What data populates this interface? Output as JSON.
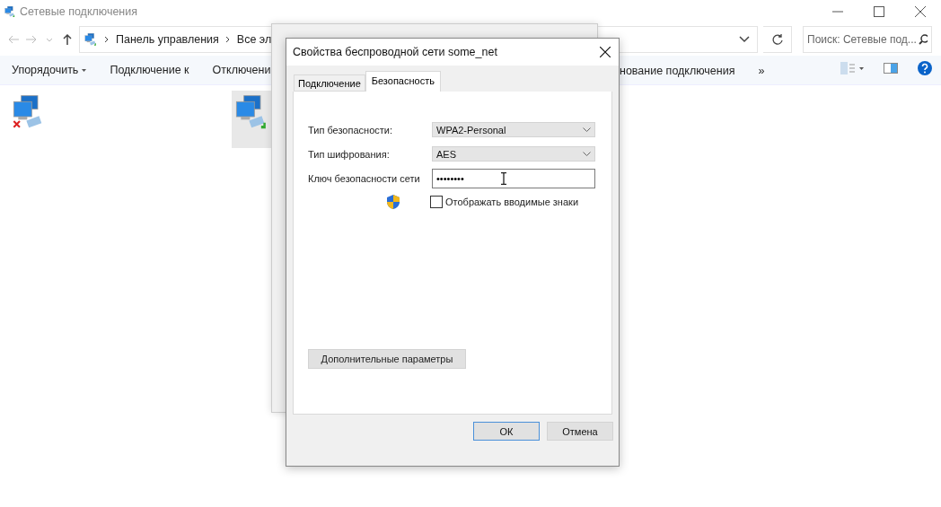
{
  "window": {
    "title": "Сетевые подключения"
  },
  "address_bar": {
    "crumbs": [
      "Панель управления",
      "Все эл"
    ]
  },
  "search": {
    "placeholder": "Поиск: Сетевые под..."
  },
  "toolbar": {
    "left": [
      {
        "label": "Упорядочить",
        "has_caret": true
      },
      {
        "label": "Подключение к",
        "has_caret": false
      },
      {
        "label": "Отключени",
        "has_caret": false
      }
    ],
    "right": [
      {
        "label": "нование подключения",
        "has_caret": false
      },
      {
        "label": "»",
        "has_caret": false
      }
    ]
  },
  "connections": [
    {
      "disconnected": true,
      "selected": false
    },
    {
      "disconnected": false,
      "selected": true
    }
  ],
  "dialog": {
    "title": "Свойства беспроводной сети some_net",
    "tabs": [
      {
        "label": "Подключение",
        "selected": false
      },
      {
        "label": "Безопасность",
        "selected": true
      }
    ],
    "fields": [
      {
        "kind": "select",
        "label": "Тип безопасности:",
        "value": "WPA2-Personal"
      },
      {
        "kind": "select",
        "label": "Тип шифрования:",
        "value": "AES"
      },
      {
        "kind": "password",
        "label": "Ключ безопасности сети",
        "value": "••••••••"
      }
    ],
    "show_chars": {
      "label": "Отображать вводимые знаки",
      "checked": false
    },
    "advanced_button": "Дополнительные параметры",
    "buttons": [
      {
        "label": "ОК",
        "default": true
      },
      {
        "label": "Отмена",
        "default": false
      }
    ]
  }
}
